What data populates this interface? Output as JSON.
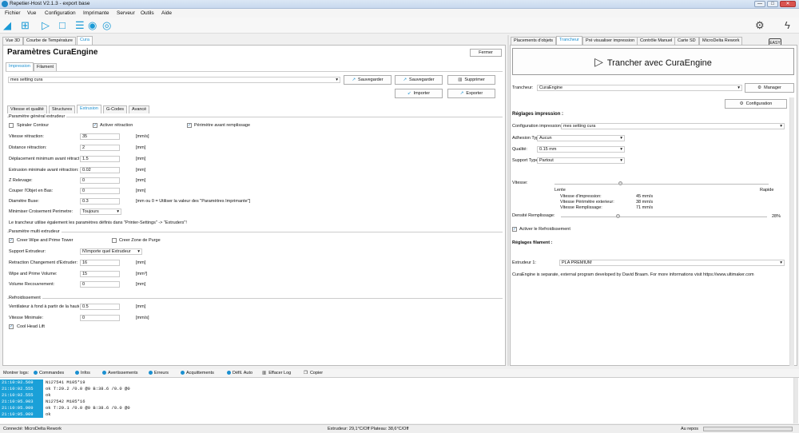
{
  "window": {
    "title": "Repetier-Host V2.1.3 - export base",
    "min": "—",
    "max": "□",
    "close": "✕"
  },
  "menu": [
    "Fichier",
    "Vue",
    "Configuration",
    "Imprimante",
    "Serveur",
    "Outils",
    "Aide"
  ],
  "toolbar_right": {
    "easy": "EASY"
  },
  "left_tabs": [
    "Vue 3D",
    "Courbe de Température",
    "Cura"
  ],
  "cura": {
    "title": "Paramètres CuraEngine",
    "close": "Fermer",
    "sub_tabs": [
      "Impression",
      "Filament"
    ],
    "profile": "mes setting cura",
    "save_as": "Sauvegarder",
    "save": "Sauvegarder",
    "delete": "Supprimer",
    "import": "Importer",
    "export": "Exporter",
    "inner_tabs": [
      "Vitesse et qualité",
      "Structures",
      "Extrusion",
      "G-Codes",
      "Avancé"
    ],
    "sec1": "Paramètre général extrudeur",
    "spiral": "Spiraler Contour",
    "retract": "Activer rétraction",
    "perimeter": "Périmètre avant remplissage",
    "rows1": [
      {
        "label": "Vitesse rétraction:",
        "value": "35",
        "unit": "[mm/s]"
      },
      {
        "label": "Distance rétraction:",
        "value": "2",
        "unit": "[mm]"
      },
      {
        "label": "Déplacement minimum avant rétracti",
        "value": "1.5",
        "unit": "[mm]"
      },
      {
        "label": "Extrusion minimale avant rétraction:",
        "value": "0.02",
        "unit": "[mm]"
      },
      {
        "label": "Z Relevage:",
        "value": "0",
        "unit": "[mm]"
      },
      {
        "label": "Couper l'Objet en Bas:",
        "value": "0",
        "unit": "[mm]"
      },
      {
        "label": "Diamètre Buse:",
        "value": "0.3",
        "unit": "[mm ou 0 = Utiliser la valeur des \"Paramètres Imprimante\"]"
      }
    ],
    "comb_label": "Minimiser Croisement Perimetre:",
    "comb_value": "Toujours",
    "note": "Le trancheur utilise également les paramètres définis dans \"Printer-Settings\" -> \"Extruders\"!",
    "sec2": "Paramètre multi extrudeur",
    "wipe": "Creer Wipe and Prime Tower",
    "purge": "Creer Zone de Purge",
    "support_label": "Support Extrudeur:",
    "support_value": "N'importe quel Extrudeur",
    "rows2": [
      {
        "label": "Retraction Changement d'Extruder:",
        "value": "16",
        "unit": "[mm]"
      },
      {
        "label": "Wipe and Prime Volume:",
        "value": "15",
        "unit": "[mm³]"
      },
      {
        "label": "Volume Recouvrement:",
        "value": "0",
        "unit": "[mm]"
      }
    ],
    "sec3": "Refroidissement",
    "rows3": [
      {
        "label": "Ventilateur à fond à partir de la hauteu",
        "value": "0.5",
        "unit": "[mm]"
      },
      {
        "label": "Vitesse Minimale:",
        "value": "0",
        "unit": "[mm/s]"
      }
    ],
    "cool": "Cool Head Lift"
  },
  "right_tabs": [
    "Placements d'objets",
    "Trancheur",
    "Pré visualiser impression",
    "Contrôle Manuel",
    "Carte SD",
    "MicroDelta Rework"
  ],
  "slicer": {
    "slice_button": "Trancher avec CuraEngine",
    "slicer_label": "Trancheur:",
    "slicer_value": "CuraEngine",
    "manager": "Manager",
    "config": "Configuration",
    "print_settings": "Réglages impression :",
    "config_label": "Configuration impression:",
    "config_value": "mes setting cura",
    "adhesion_label": "Adhesion Type:",
    "adhesion_value": "Aucun",
    "quality_label": "Qualité:",
    "quality_value": "0.15 mm",
    "support_label": "Support Type:",
    "support_value": "Partout",
    "speed_label": "Vitesse:",
    "slow": "Lente",
    "fast": "Rapide",
    "speed_stats": [
      {
        "label": "Vitesse d'impression:",
        "value": "45 mm/s"
      },
      {
        "label": "Vitesse Périmètre exterieur:",
        "value": "38 mm/s"
      },
      {
        "label": "Vitesse Remplissage:",
        "value": "71 mm/s"
      }
    ],
    "speed_level": 0.31,
    "density_label": "Densité Remplissage:",
    "density_value": "28%",
    "density_level": 0.28,
    "cooling": "Activer le Refroidissement",
    "filament_settings": "Réglages filament :",
    "extruder_label": "Extrudeur 1:",
    "extruder_value": "PLA PREMIUM",
    "info": "CuraEngine is separate, external program developed by David Braam. For more informations visit https://www.ultimaker.com"
  },
  "logbar": {
    "label": "Montrer logs:",
    "items": [
      "Commandes",
      "Infos",
      "Avertissements",
      "Erreurs",
      "Acquittements",
      "Défil. Auto"
    ],
    "clear": "Effacer Log",
    "copy": "Copier"
  },
  "log": [
    {
      "ts": "21:10:02.569",
      "msg": "N127541 M105*19"
    },
    {
      "ts": "21:10:02.555",
      "msg": "ok T:29.2 /0.0 @0 B:38.6 /0.0 @0"
    },
    {
      "ts": "21:10:02.555",
      "msg": "ok"
    },
    {
      "ts": "21:10:05.903",
      "msg": "N127542 M105*16"
    },
    {
      "ts": "21:10:05.909",
      "msg": "ok T:29.1 /0.0 @0 B:38.6 /0.0 @0"
    },
    {
      "ts": "21:10:05.909",
      "msg": "ok"
    }
  ],
  "status": {
    "left": "Connecté: MicroDelta Rework",
    "center": "Extrudeur: 29,1°C/Off Plateau: 38,6°C/Off",
    "right": "Au repos"
  },
  "colors": {
    "accent": "#1a8fd0",
    "log_ts": "#1aa0d8"
  }
}
